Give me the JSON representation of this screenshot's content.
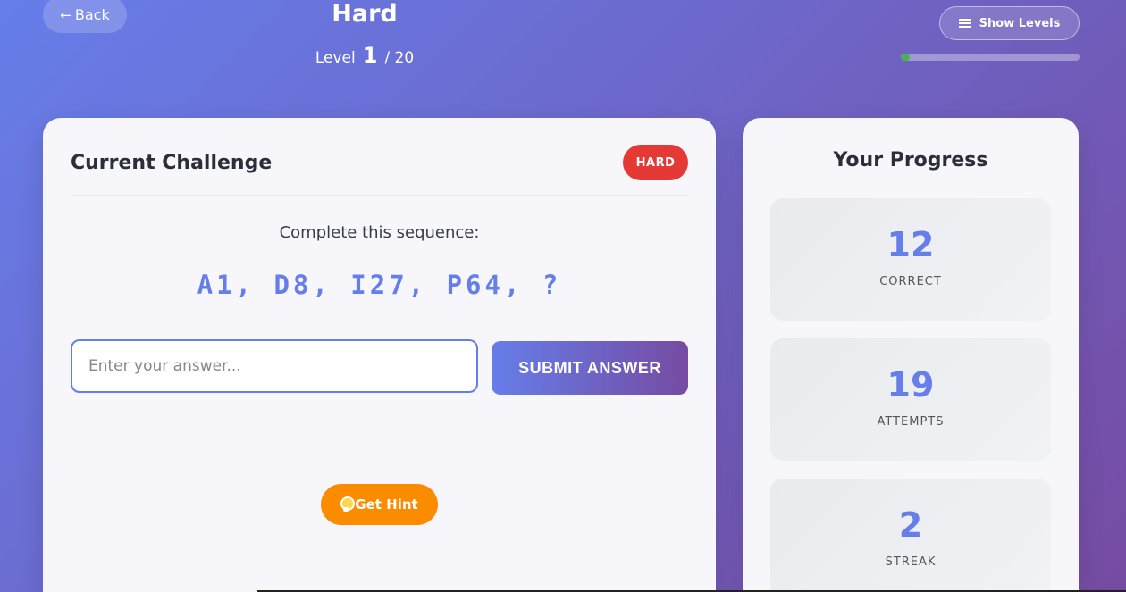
{
  "header": {
    "back_label": "Back",
    "difficulty": "Hard",
    "level_prefix": "Level",
    "level_current": "1",
    "level_total": "/ 20",
    "show_levels_label": "Show Levels",
    "progress_fraction": 0.05,
    "progress_color": "#4caf50"
  },
  "challenge": {
    "title": "Current Challenge",
    "badge": "HARD",
    "prompt": "Complete this sequence:",
    "sequence": "A1, D8, I27, P64, ?",
    "input_placeholder": "Enter your answer...",
    "input_value": "",
    "submit_label": "SUBMIT ANSWER",
    "hint_label": "Get Hint"
  },
  "progress": {
    "title": "Your Progress",
    "stats": [
      {
        "value": "12",
        "label": "CORRECT"
      },
      {
        "value": "19",
        "label": "ATTEMPTS"
      },
      {
        "value": "2",
        "label": "STREAK"
      }
    ]
  },
  "colors": {
    "accent": "#667eea",
    "accent_end": "#764ba2",
    "badge_hard": "#e53935",
    "hint": "#fb8c00"
  },
  "icons": {
    "back": "arrow-left-icon",
    "show_levels": "list-icon",
    "hint": "lightbulb-icon"
  }
}
